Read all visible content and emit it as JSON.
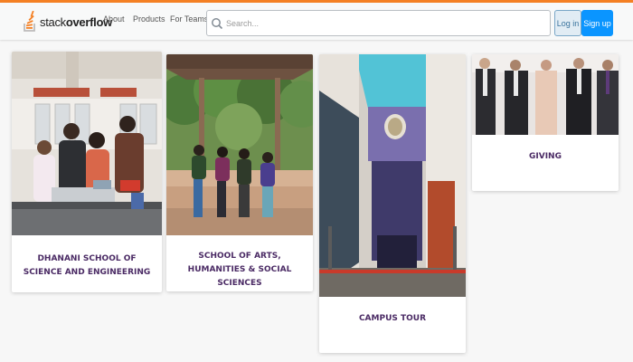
{
  "header": {
    "logo_prefix": "stack",
    "logo_suffix": "overflow",
    "nav": [
      "About",
      "Products",
      "For Teams"
    ],
    "search_placeholder": "Search...",
    "login_label": "Log in",
    "signup_label": "Sign up"
  },
  "cards": [
    {
      "title": "DHANANI SCHOOL OF SCIENCE AND ENGINEERING",
      "photo": "students-in-lab-photo"
    },
    {
      "title": "SCHOOL OF ARTS, HUMANITIES & SOCIAL SCIENCES",
      "photo": "students-in-pavilion-photo"
    },
    {
      "title": "CAMPUS TOUR",
      "photo": "campus-building-photo"
    },
    {
      "title": "GIVING",
      "photo": "donors-group-photo"
    }
  ],
  "colors": {
    "accent_orange": "#f48024",
    "signup_blue": "#0a95ff",
    "card_title_purple": "#4a2a64"
  }
}
